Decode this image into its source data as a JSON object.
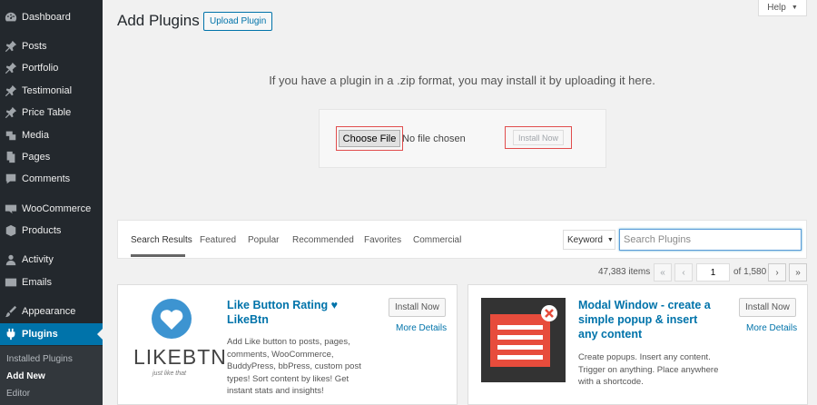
{
  "sidebar": {
    "items": [
      {
        "label": "Dashboard",
        "icon": "dashboard-icon"
      },
      {
        "label": "Posts",
        "icon": "pin-icon"
      },
      {
        "label": "Portfolio",
        "icon": "pin-icon"
      },
      {
        "label": "Testimonial",
        "icon": "pin-icon"
      },
      {
        "label": "Price Table",
        "icon": "pin-icon"
      },
      {
        "label": "Media",
        "icon": "media-icon"
      },
      {
        "label": "Pages",
        "icon": "pages-icon"
      },
      {
        "label": "Comments",
        "icon": "comment-icon"
      },
      {
        "label": "WooCommerce",
        "icon": "woocommerce-icon"
      },
      {
        "label": "Products",
        "icon": "products-icon"
      },
      {
        "label": "Activity",
        "icon": "activity-icon"
      },
      {
        "label": "Emails",
        "icon": "email-icon"
      },
      {
        "label": "Appearance",
        "icon": "appearance-icon"
      },
      {
        "label": "Plugins",
        "icon": "plugins-icon"
      }
    ],
    "submenu": [
      "Installed Plugins",
      "Add New",
      "Editor"
    ]
  },
  "header": {
    "title": "Add Plugins",
    "upload_label": "Upload Plugin",
    "help_label": "Help"
  },
  "upload": {
    "instructions": "If you have a plugin in a .zip format, you may install it by uploading it here.",
    "choose_label": "Choose File",
    "no_file": "No file chosen",
    "install_label": "Install Now"
  },
  "filters": {
    "tabs": [
      "Search Results",
      "Featured",
      "Popular",
      "Recommended",
      "Favorites",
      "Commercial"
    ],
    "keyword_label": "Keyword",
    "search_placeholder": "Search Plugins"
  },
  "pagination": {
    "items": "47,383 items",
    "first": "«",
    "prev": "‹",
    "current": "1",
    "of": "of 1,580",
    "next": "›",
    "last": "»"
  },
  "cards": [
    {
      "title_line1": "Like Button Rating ♥",
      "title_line2": "LikeBtn",
      "desc": [
        "Add Like button to posts, pages,",
        "comments, WooCommerce,",
        "BuddyPress, bbPress, custom post",
        "types! Sort content by likes! Get",
        "instant stats and insights!"
      ],
      "install_label": "Install Now",
      "more_label": "More Details",
      "logo_text": "LIKEBTN",
      "logo_tagline": "just like that"
    },
    {
      "title_lines": [
        "Modal Window - create a",
        "simple popup & insert",
        "any content"
      ],
      "desc": [
        "Create popups. Insert any content.",
        "Trigger on anything. Place anywhere",
        "with a shortcode."
      ],
      "install_label": "Install Now",
      "more_label": "More Details"
    }
  ],
  "colors": {
    "sidebar_bg": "#23282d",
    "accent": "#0073aa",
    "highlight_border": "#e14d4d",
    "likebtn_blue": "#3d94d1",
    "modal_red": "#e74c3c"
  }
}
